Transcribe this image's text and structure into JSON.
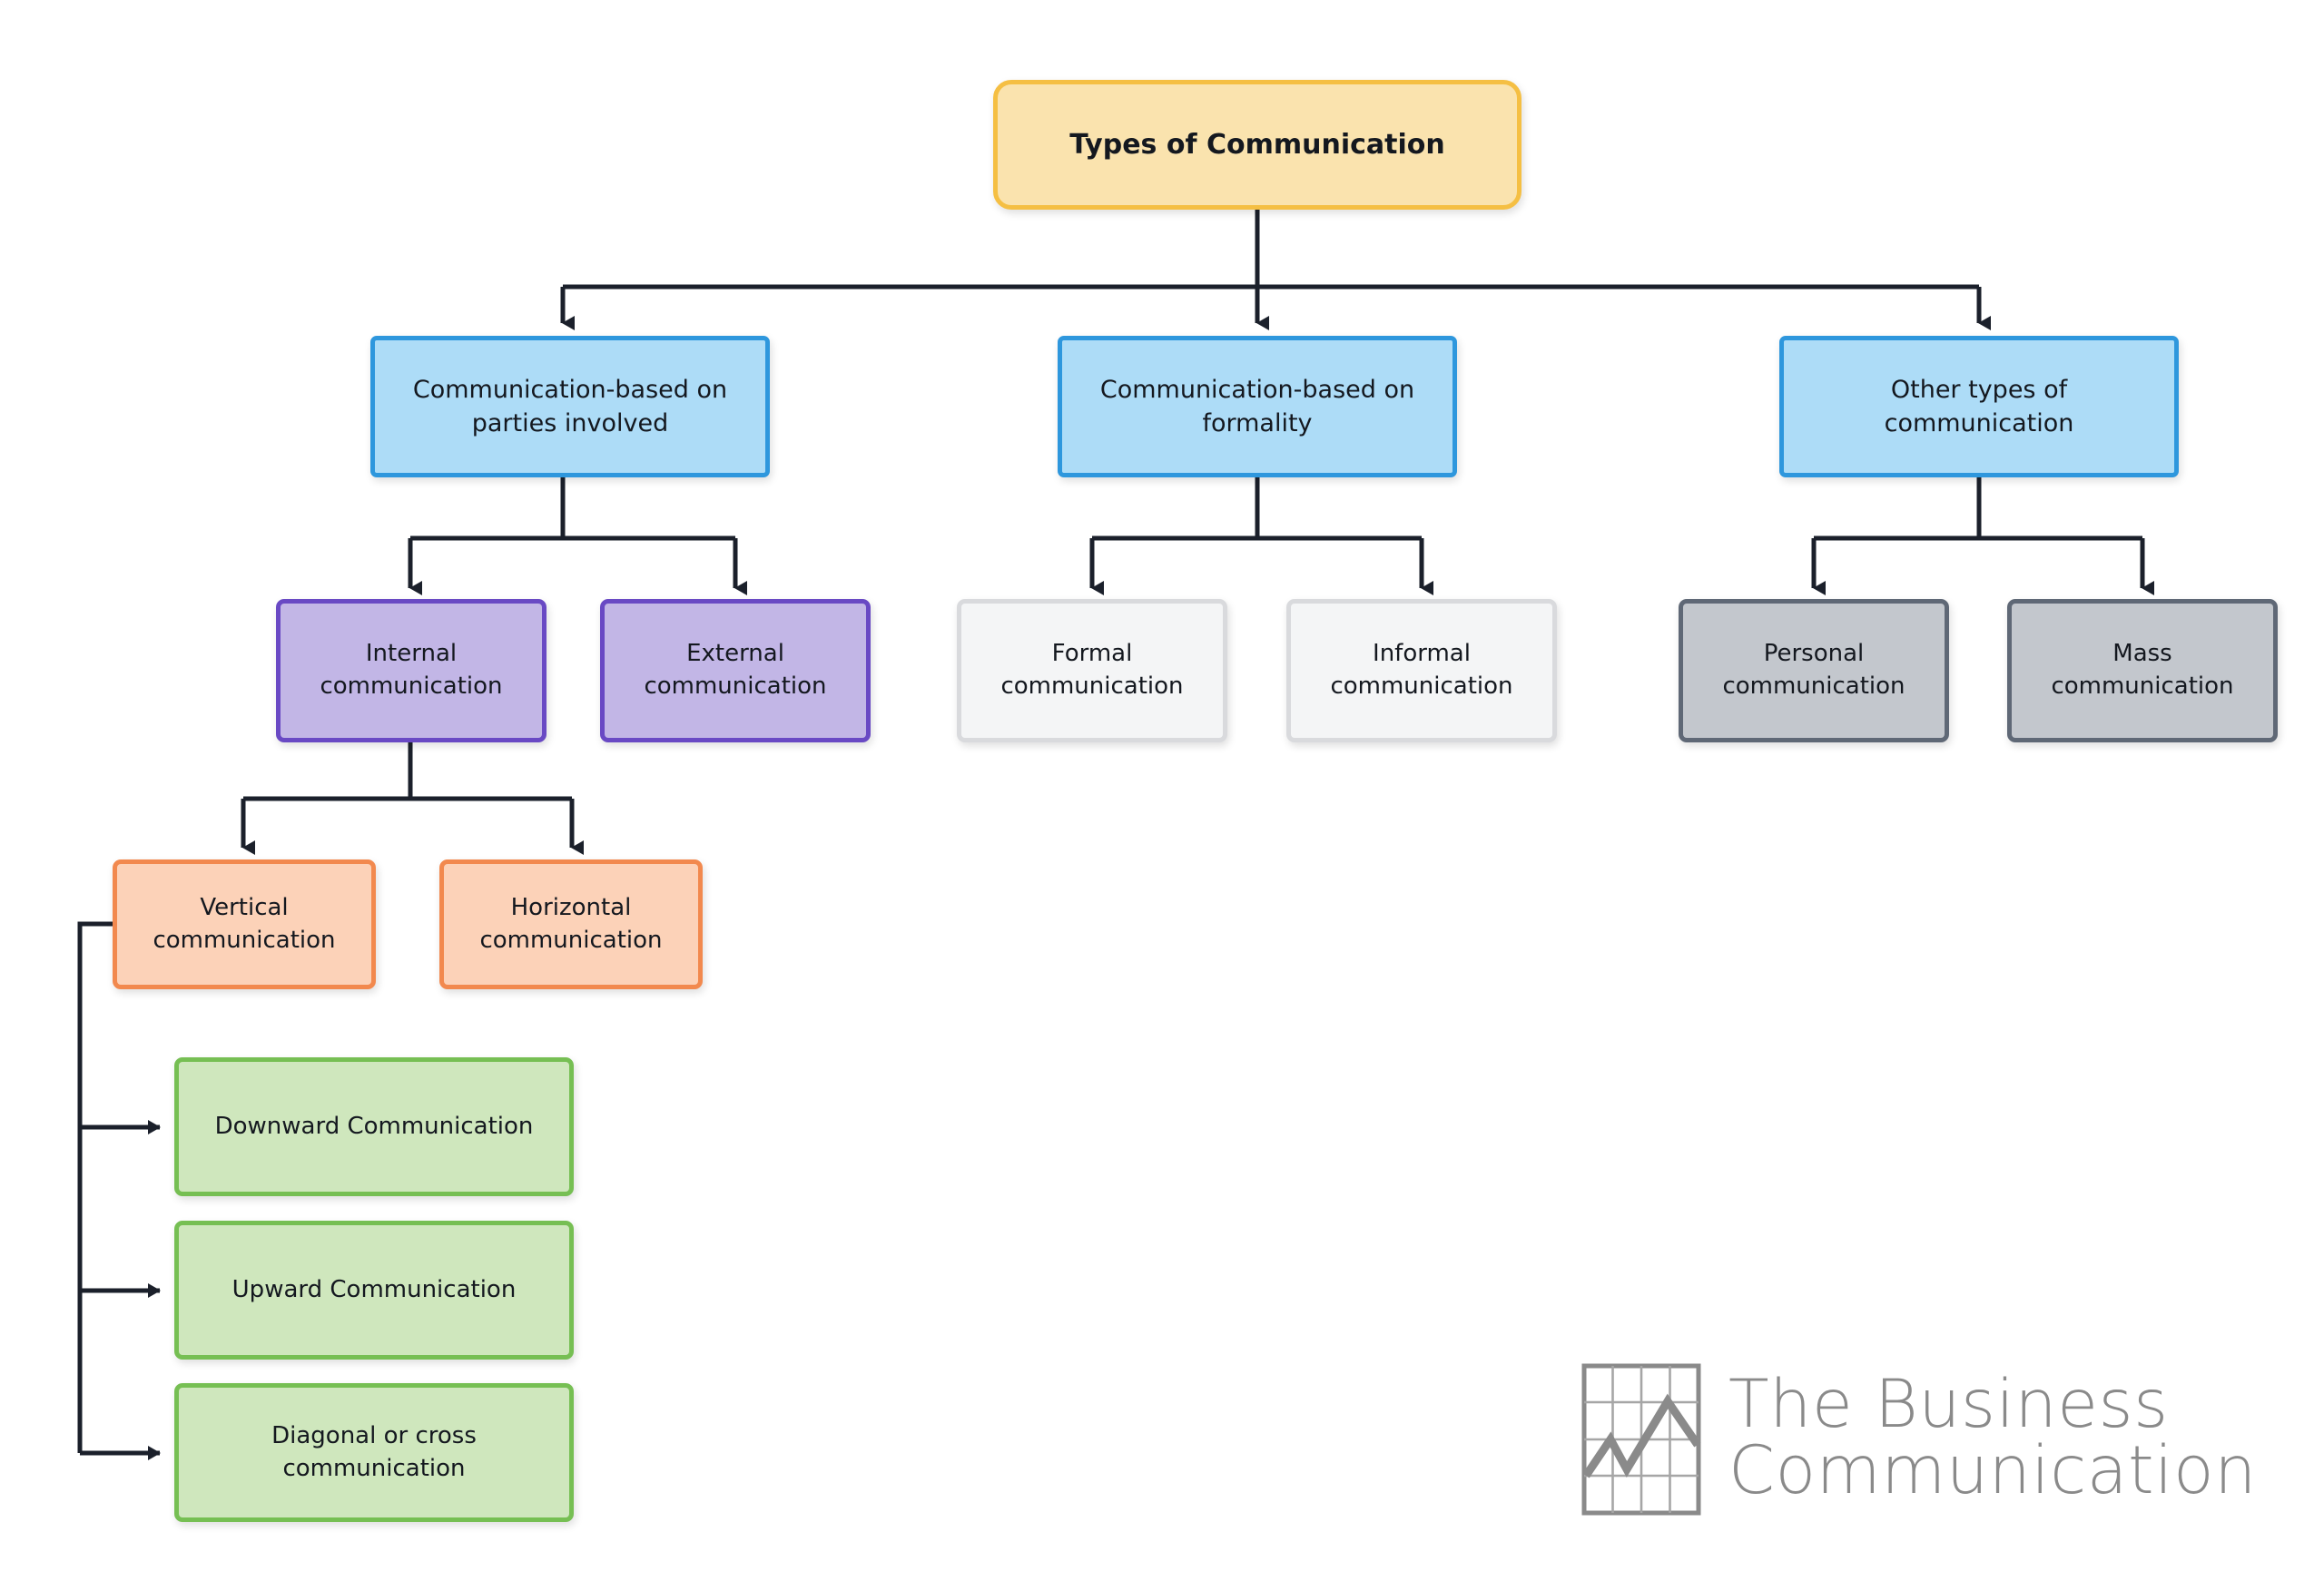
{
  "diagram": {
    "title": "Types of Communication",
    "root": {
      "label": "Types of Communication"
    },
    "level2": [
      {
        "label": "Communication-based on\nparties involved"
      },
      {
        "label": "Communication-based on\nformality"
      },
      {
        "label": "Other types of\ncommunication"
      }
    ],
    "level3": [
      {
        "label": "Internal\ncommunication"
      },
      {
        "label": "External\ncommunication"
      },
      {
        "label": "Formal\ncommunication"
      },
      {
        "label": "Informal\ncommunication"
      },
      {
        "label": "Personal\ncommunication"
      },
      {
        "label": "Mass\ncommunication"
      }
    ],
    "level4": [
      {
        "label": "Vertical\ncommunication"
      },
      {
        "label": "Horizontal\ncommunication"
      }
    ],
    "level5": [
      {
        "label": "Downward Communication"
      },
      {
        "label": "Upward Communication"
      },
      {
        "label": "Diagonal or cross\ncommunication"
      }
    ],
    "colors": {
      "root_fill": "#fae3ae",
      "root_border": "#f5bf43",
      "blue_fill": "#addcf7",
      "blue_border": "#2e97dd",
      "purple_fill": "#c2b6e6",
      "purple_border": "#6949c4",
      "white_fill": "#f4f5f6",
      "white_border": "#d9dadd",
      "gray_fill": "#c3c7cd",
      "gray_border": "#5f6876",
      "orange_fill": "#fcd2b8",
      "orange_border": "#f2894e",
      "green_fill": "#cfe7bd",
      "green_border": "#76bf53",
      "connector": "#1b202b",
      "background": "#ffffff",
      "logo": "#8a8a8a"
    }
  },
  "logo": {
    "line1": "The Business",
    "line2": "Communication",
    "icon": "grid-line-chart-icon"
  }
}
